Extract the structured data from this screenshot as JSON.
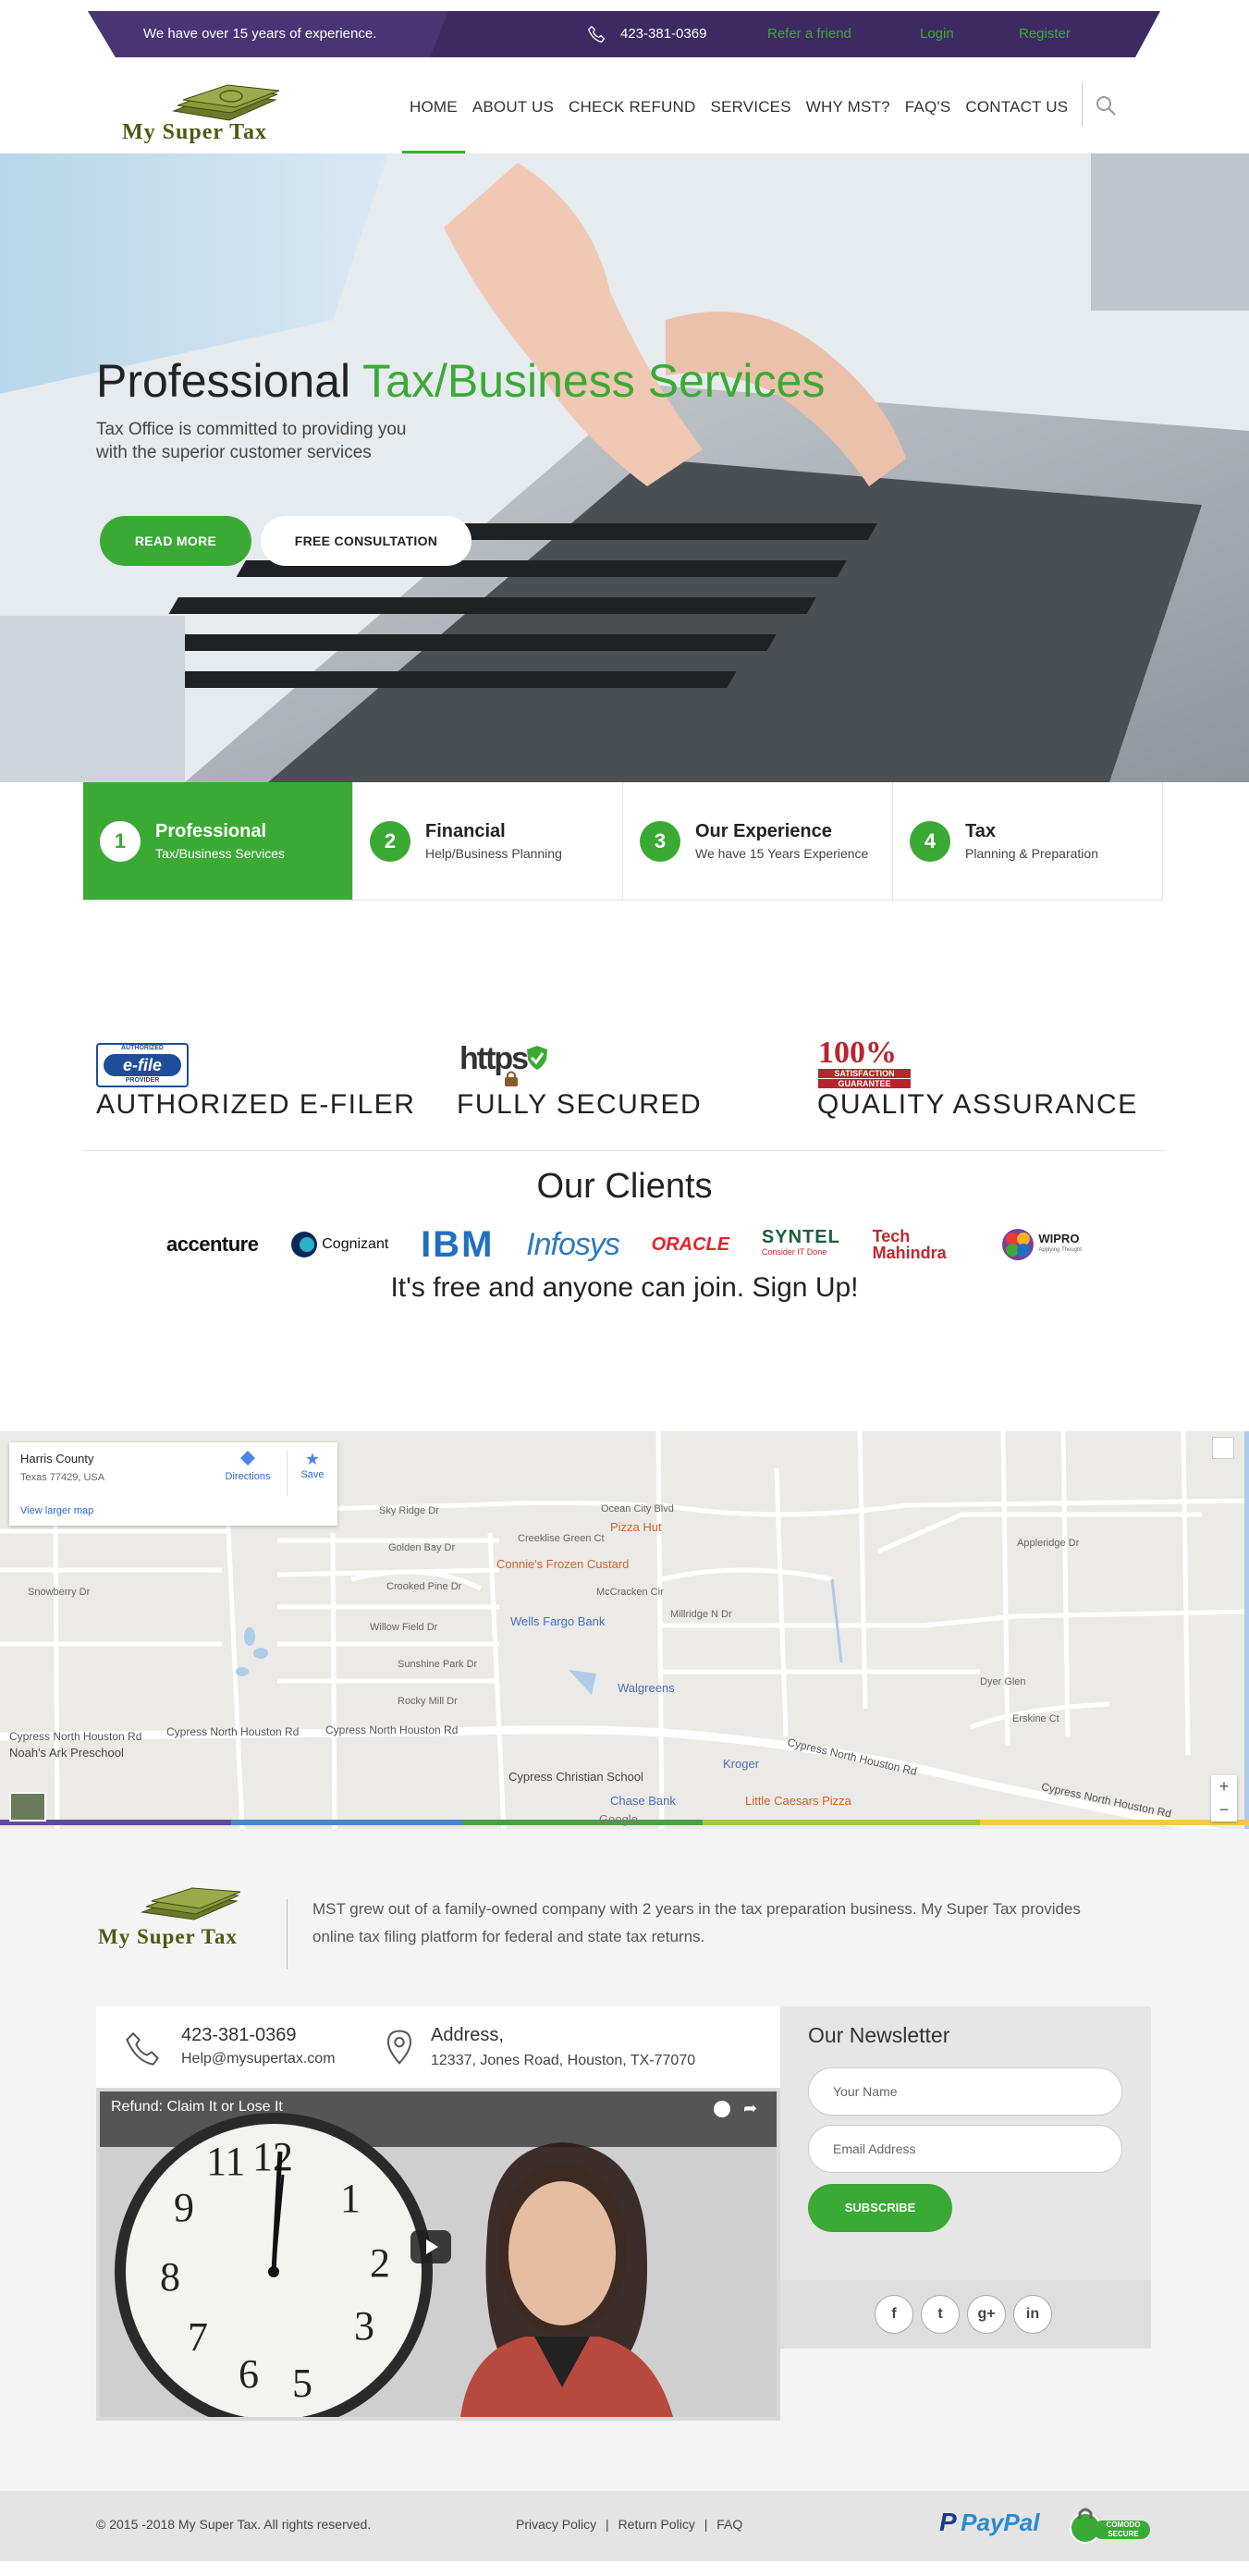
{
  "topbar": {
    "tagline": "We have over 15 years of experience.",
    "phone": "423-381-0369",
    "refer": "Refer a friend",
    "login": "Login",
    "register": "Register"
  },
  "brand": {
    "name": "My Super Tax"
  },
  "nav": {
    "items": [
      {
        "label": "HOME"
      },
      {
        "label": "ABOUT US"
      },
      {
        "label": "CHECK REFUND"
      },
      {
        "label": "SERVICES"
      },
      {
        "label": "WHY MST?"
      },
      {
        "label": "FAQ'S"
      },
      {
        "label": "CONTACT US"
      }
    ]
  },
  "hero": {
    "title_plain": "Professional ",
    "title_accent": "Tax/Business Services",
    "subtitle": "Tax Office is committed to providing you with the superior customer services",
    "read_more": "READ MORE",
    "free_consultation": "FREE CONSULTATION"
  },
  "features": [
    {
      "num": "1",
      "title": "Professional",
      "sub": "Tax/Business Services"
    },
    {
      "num": "2",
      "title": "Financial",
      "sub": "Help/Business Planning"
    },
    {
      "num": "3",
      "title": "Our Experience",
      "sub": "We have 15 Years Experience"
    },
    {
      "num": "4",
      "title": "Tax",
      "sub": "Planning & Preparation"
    }
  ],
  "badges": {
    "efile_logo": "e-file",
    "efile_top": "AUTHORIZED",
    "efile_bottom": "PROVIDER",
    "efiler": "AUTHORIZED E-FILER",
    "https_logo": "https",
    "secured": "FULLY SECURED",
    "guarantee_pct": "100%",
    "guarantee_line1": "SATISFACTION",
    "guarantee_line2": "GUARANTEE",
    "quality": "QUALITY ASSURANCE"
  },
  "clients": {
    "title": "Our Clients",
    "logos": [
      "accenture",
      "Cognizant",
      "IBM",
      "Infosys",
      "ORACLE",
      "SYNTEL",
      "Tech Mahindra",
      "WIPRO"
    ],
    "syntel_tag": "Consider IT Done",
    "wipro_tag": "Applying Thought",
    "signup": "It's free and anyone can join. Sign Up!"
  },
  "map": {
    "place": "Harris County",
    "address": "Texas 77429, USA",
    "larger": "View larger map",
    "directions": "Directions",
    "save": "Save",
    "pois": [
      "Pizza Hut",
      "Connie's Frozen Custard",
      "Wells Fargo Bank",
      "Walgreens",
      "Noah's Ark Preschool",
      "Cypress Christian School",
      "Chase Bank",
      "Little Caesars Pizza",
      "Kroger"
    ],
    "roads": [
      "Cypress North Houston Rd",
      "Cypress North Houston Rd",
      "Cypress North Houston Rd",
      "Cypress North Houston Rd",
      "Cypress North Houston Rd",
      "Ocean City Blvd",
      "Creeklise Green Ct",
      "Sky Ridge Dr",
      "Golden Bay Dr",
      "Crooked Pine Dr",
      "Willow Field Dr",
      "Sunshine Park Dr",
      "Rocky Mill Dr",
      "Millridge N Dr",
      "Appleridge Dr",
      "Dyer Glen",
      "Erskine Ct",
      "Snowberry Dr",
      "McCracken Cir"
    ],
    "zoom_in": "+",
    "zoom_out": "−",
    "google": "Google"
  },
  "footer": {
    "description": "MST grew out of a family-owned company with 2 years in the tax preparation business. My Super Tax provides online tax filing platform for federal and state tax returns.",
    "phone": "423-381-0369",
    "email": "Help@mysupertax.com",
    "address_label": "Address,",
    "address": "12337, Jones Road, Houston, TX-77070",
    "video_title": "Refund: Claim It or Lose It",
    "newsletter_title": "Our Newsletter",
    "name_placeholder": "Your Name",
    "email_placeholder": "Email Address",
    "subscribe": "SUBSCRIBE",
    "social": [
      "f",
      "t",
      "g+",
      "in"
    ]
  },
  "bottom": {
    "copyright": "© 2015 -2018 My Super Tax. All rights reserved.",
    "privacy": "Privacy Policy",
    "return": "Return Policy",
    "faq": "FAQ",
    "sep": "|",
    "paypal": "PayPal",
    "comodo_top": "COMODO",
    "comodo_bottom": "SECURE"
  },
  "colors": {
    "brand_green": "#3aaa35",
    "topbar_purple": "#3d2a63",
    "olive": "#4c5a14"
  }
}
